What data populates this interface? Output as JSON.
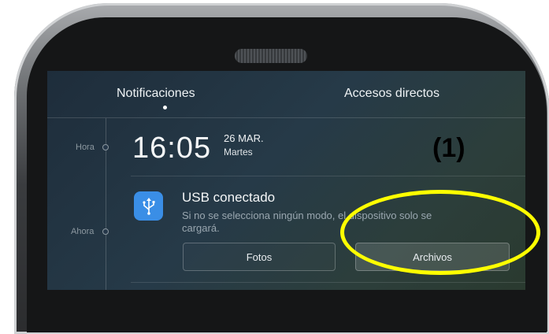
{
  "tabs": {
    "notifications": "Notificaciones",
    "shortcuts": "Accesos directos"
  },
  "timeline": {
    "hora": "Hora",
    "ahora": "Ahora"
  },
  "clock": {
    "time": "16:05",
    "date": "26 MAR.",
    "day": "Martes"
  },
  "notification": {
    "icon": "usb-icon",
    "title": "USB conectado",
    "body": "Si no se selecciona ningún modo, el dispositivo solo se cargará.",
    "button_photos": "Fotos",
    "button_files": "Archivos"
  },
  "annotation": {
    "label": "(1)",
    "highlight_color": "#ffff00"
  },
  "colors": {
    "usb_icon_bg": "#3a8ee6",
    "screen_bg": "#263a48"
  }
}
